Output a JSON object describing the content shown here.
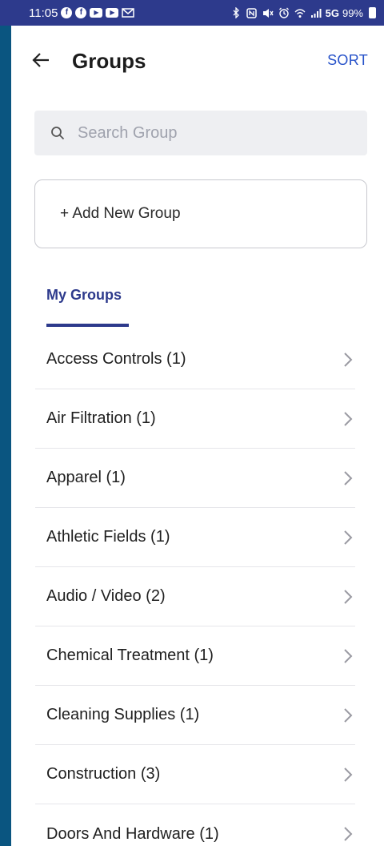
{
  "status_bar": {
    "time": "11:05",
    "network": "5G",
    "battery": "99%"
  },
  "header": {
    "title": "Groups",
    "sort_label": "SORT"
  },
  "search": {
    "placeholder": "Search Group"
  },
  "add_group": {
    "label": "+ Add New Group"
  },
  "tabs": {
    "active_label": "My Groups"
  },
  "groups": [
    {
      "label": "Access Controls (1)"
    },
    {
      "label": "Air Filtration (1)"
    },
    {
      "label": "Apparel (1)"
    },
    {
      "label": "Athletic Fields (1)"
    },
    {
      "label": "Audio / Video (2)"
    },
    {
      "label": "Chemical Treatment (1)"
    },
    {
      "label": "Cleaning Supplies (1)"
    },
    {
      "label": "Construction (3)"
    },
    {
      "label": "Doors And Hardware (1)"
    }
  ],
  "colors": {
    "status_bar": "#2d3a8c",
    "accent": "#2752c9",
    "tab_active": "#2d3a8c",
    "side_background": "#0a5580"
  }
}
